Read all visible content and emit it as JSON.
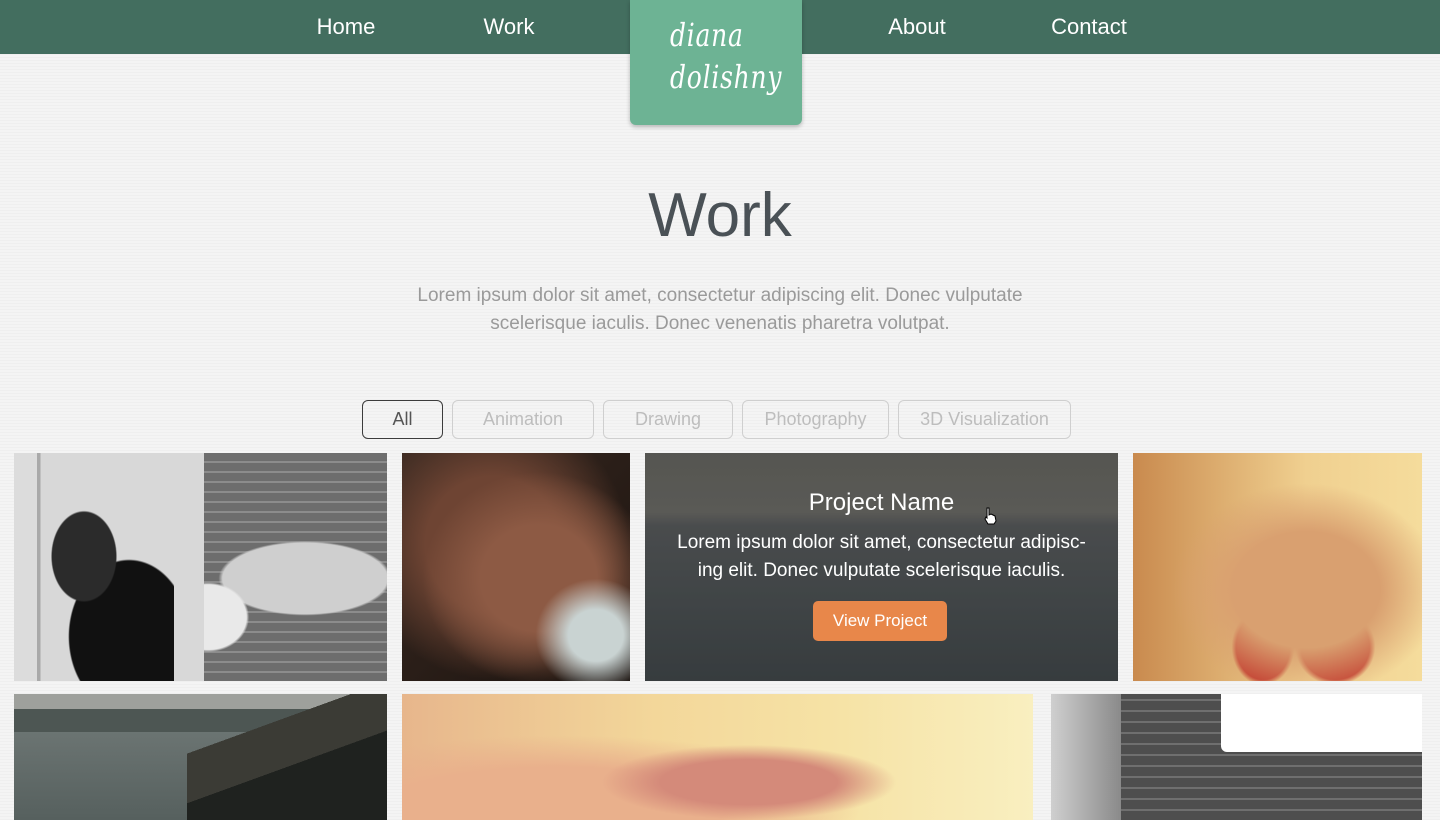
{
  "nav": {
    "home": "Home",
    "work": "Work",
    "about": "About",
    "contact": "Contact"
  },
  "logo": {
    "line1": "diana",
    "line2": "dolishny"
  },
  "page": {
    "title": "Work",
    "intro": "Lorem ipsum dolor sit amet, consectetur adipiscing elit. Donec vulputate scelerisque iaculis. Donec venenatis pharetra volutpat."
  },
  "filters": {
    "all": "All",
    "animation": "Animation",
    "drawing": "Drawing",
    "photography": "Photography",
    "visualization": "3D Visualization",
    "active": "All"
  },
  "hover_card": {
    "name": "Project Name",
    "description": "Lorem ipsum dolor sit amet, consectetur adipisc-ing elit. Donec vulputate scelerisque iaculis.",
    "button": "View Project"
  },
  "colors": {
    "nav_bg": "#436e5f",
    "logo_bg": "#6db394",
    "accent_button": "#e8874a"
  }
}
